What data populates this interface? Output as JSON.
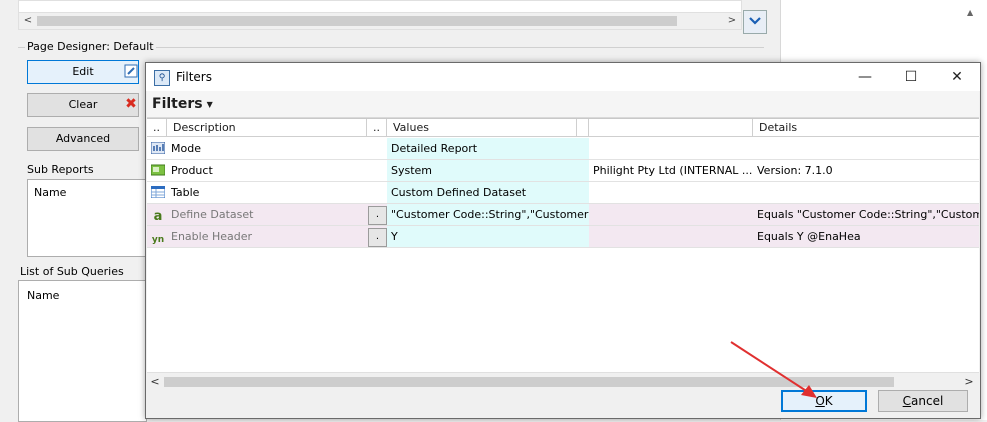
{
  "background": {
    "page_designer_label": "Page Designer: Default",
    "buttons": {
      "edit": "Edit",
      "clear": "Clear",
      "advanced": "Advanced"
    },
    "sub_reports": {
      "label": "Sub Reports",
      "column": "Name"
    },
    "sub_queries": {
      "label": "List of Sub Queries",
      "column": "Name"
    },
    "scroll_left": "<",
    "scroll_right": ">"
  },
  "dialog": {
    "title": "Filters",
    "controls": {
      "minimize": "—",
      "maximize": "☐",
      "close": "✕"
    },
    "filters_menu": "Filters",
    "grid": {
      "headers": {
        "marker": "..",
        "description": "Description",
        "values_marker": "..",
        "values": "Values",
        "blank": "",
        "details": "Details"
      },
      "rows": [
        {
          "icon": "mode-icon",
          "description": "Mode",
          "value": "Detailed Report",
          "extra": "",
          "details": "",
          "disabled": false
        },
        {
          "icon": "product-icon",
          "description": "Product",
          "value": "System",
          "extra": "Philight Pty Ltd (INTERNAL ...",
          "details": "Version: 7.1.0",
          "disabled": false
        },
        {
          "icon": "table-icon",
          "description": "Table",
          "value": "Custom Defined Dataset",
          "extra": "",
          "details": "",
          "disabled": false
        },
        {
          "icon": "text-a-icon",
          "description": "Define Dataset",
          "ellipsis": ".",
          "value": "\"Customer Code::String\",\"Customer ...",
          "extra": "",
          "details": "Equals \"Customer Code::String\",\"Customer Nan",
          "disabled": true
        },
        {
          "icon": "yes-no-icon",
          "description": "Enable Header",
          "ellipsis": ".",
          "value": "Y",
          "extra": "",
          "details": "Equals Y @EnaHea",
          "disabled": true
        }
      ],
      "scroll_left": "<",
      "scroll_right": ">"
    },
    "ok_label": "OK",
    "cancel_label": "Cancel"
  },
  "colors": {
    "values_column_bg": "#e0fbfb",
    "disabled_row_bg": "#f3e8f1",
    "accent": "#0078d7",
    "arrow": "#e03030"
  }
}
